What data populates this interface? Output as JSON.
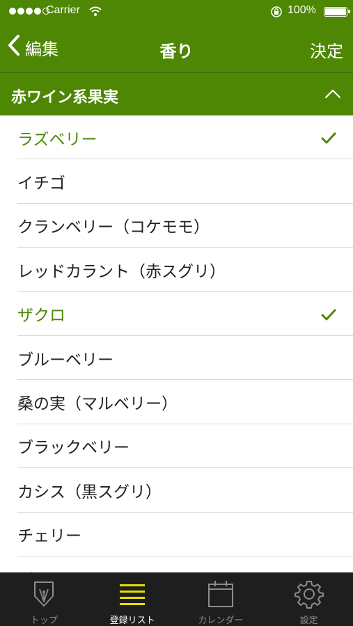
{
  "status_bar": {
    "carrier": "Carrier",
    "battery": "100%",
    "signal_bars": 4
  },
  "nav": {
    "back_label": "編集",
    "title": "香り",
    "done_label": "決定"
  },
  "section": {
    "title": "赤ワイン系果実"
  },
  "items": [
    {
      "label": "ラズベリー",
      "selected": true
    },
    {
      "label": "イチゴ",
      "selected": false
    },
    {
      "label": "クランベリー（コケモモ）",
      "selected": false
    },
    {
      "label": "レッドカラント（赤スグリ）",
      "selected": false
    },
    {
      "label": "ザクロ",
      "selected": true
    },
    {
      "label": "ブルーベリー",
      "selected": false
    },
    {
      "label": "桑の実（マルベリー）",
      "selected": false
    },
    {
      "label": "ブラックベリー",
      "selected": false
    },
    {
      "label": "カシス（黒スグリ）",
      "selected": false
    },
    {
      "label": "チェリー",
      "selected": false
    },
    {
      "label": "ブラックチェリー",
      "selected": false
    }
  ],
  "tabs": [
    {
      "label": "トップ",
      "icon": "pen-nib-icon",
      "active": false
    },
    {
      "label": "登録リスト",
      "icon": "list-icon",
      "active": true
    },
    {
      "label": "カレンダー",
      "icon": "calendar-icon",
      "active": false
    },
    {
      "label": "設定",
      "icon": "gear-icon",
      "active": false
    }
  ],
  "colors": {
    "brand_green": "#4e8704",
    "tab_bar": "#1e1e1e",
    "active_tab_icon": "#e8e000"
  }
}
